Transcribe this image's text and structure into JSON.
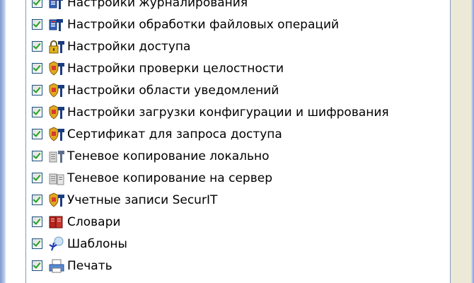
{
  "list": {
    "items": [
      {
        "label": "Настройки журналирования",
        "icon": "log-settings-icon",
        "checked": true
      },
      {
        "label": "Настройки обработки файловых операций",
        "icon": "file-ops-settings-icon",
        "checked": true
      },
      {
        "label": "Настройки доступа",
        "icon": "access-lock-icon",
        "checked": true
      },
      {
        "label": "Настройки проверки целостности",
        "icon": "integrity-shield-icon",
        "checked": true
      },
      {
        "label": "Настройки области уведомлений",
        "icon": "notification-shield-icon",
        "checked": true
      },
      {
        "label": "Настройки загрузки конфигурации и шифрования",
        "icon": "config-encryption-shield-icon",
        "checked": true
      },
      {
        "label": "Сертификат для запроса доступа",
        "icon": "certificate-shield-icon",
        "checked": true
      },
      {
        "label": "Теневое копирование локально",
        "icon": "shadow-copy-local-icon",
        "checked": true
      },
      {
        "label": "Теневое копирование на сервер",
        "icon": "shadow-copy-server-icon",
        "checked": true
      },
      {
        "label": "Учетные записи SecurIT",
        "icon": "accounts-shield-icon",
        "checked": true
      },
      {
        "label": "Словари",
        "icon": "dictionary-book-icon",
        "checked": true
      },
      {
        "label": "Шаблоны",
        "icon": "templates-icon",
        "checked": true
      },
      {
        "label": "Печать",
        "icon": "print-icon",
        "checked": true
      }
    ]
  },
  "colors": {
    "checkmark": "#21a121",
    "checkbox_border": "#1c5180",
    "scroll_thumb": "#c1d3fb",
    "list_border": "#7f9db9"
  }
}
